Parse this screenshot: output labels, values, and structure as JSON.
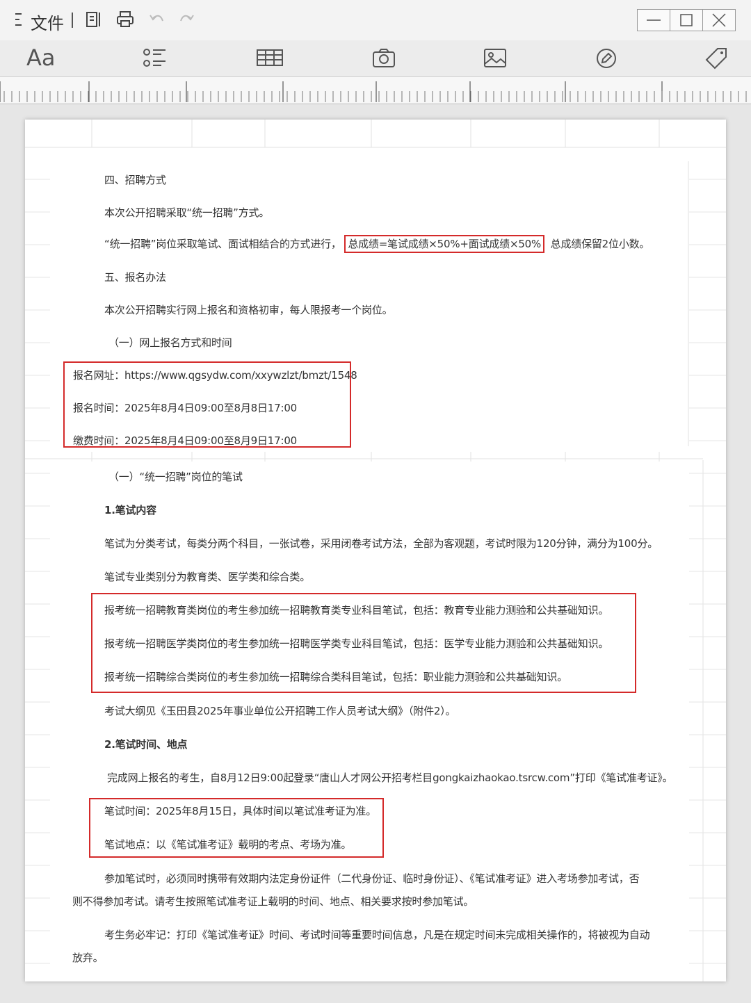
{
  "titlebar": {
    "menu_icon": "menu-icon",
    "file_label": "文件",
    "icons": [
      "preview-icon",
      "print-icon",
      "undo-icon",
      "redo-icon"
    ]
  },
  "window_controls": [
    "minimize-icon",
    "maximize-icon",
    "close-icon"
  ],
  "toolbar": {
    "font_label": "Aa",
    "icons": [
      "list-icon",
      "table-icon",
      "camera-icon",
      "image-icon",
      "edit-icon",
      "tag-icon"
    ]
  },
  "colors": {
    "highlight_border": "#d42a2a",
    "page_bg": "#ffffff",
    "app_bg": "#e6e6e6"
  },
  "document": {
    "s4_heading": "四、招聘方式",
    "s4_p1": "本次公开招聘采取“统一招聘”方式。",
    "s4_p2_pre": "“统一招聘”岗位采取笔试、面试相结合的方式进行，",
    "s4_p2_box": "总成绩=笔试成绩×50%+面试成绩×50%",
    "s4_p2_post": "总成绩保留2位小数。",
    "s5_heading": "五、报名办法",
    "s5_p1": "本次公开招聘实行网上报名和资格初审，每人限报考一个岗位。",
    "s5_sub1": "（一）网上报名方式和时间",
    "reg_url": "报名网址：https://www.qgsydw.com/xxywzlzt/bmzt/1548",
    "reg_time": "报名时间：2025年8月4日09:00至8月8日17:00",
    "pay_time": "缴费时间：2025年8月4日09:00至8月9日17:00",
    "exam_sub": "（一）“统一招聘”岗位的笔试",
    "exam_content_heading": "1.笔试内容",
    "exam_p1": "笔试为分类考试，每类分两个科目，一张试卷，采用闭卷考试方法，全部为客观题，考试时限为120分钟，满分为100分。",
    "exam_p2": "笔试专业类别分为教育类、医学类和综合类。",
    "exam_edu": "报考统一招聘教育类岗位的考生参加统一招聘教育类专业科目笔试，包括：教育专业能力测验和公共基础知识。",
    "exam_med": "报考统一招聘医学类岗位的考生参加统一招聘医学类专业科目笔试，包括：医学专业能力测验和公共基础知识。",
    "exam_gen": "报考统一招聘综合类岗位的考生参加统一招聘综合类科目笔试，包括：职业能力测验和公共基础知识。",
    "exam_outline": "考试大纲见《玉田县2025年事业单位公开招聘工作人员考试大纲》（附件2）。",
    "exam_time_heading": "2.笔试时间、地点",
    "exam_ticket": "完成网上报名的考生，自8月12日9:00起登录“唐山人才网公开招考栏目gongkaizhaokao.tsrcw.com”打印《笔试准考证》。",
    "exam_date": "笔试时间：2025年8月15日，具体时间以笔试准考证为准。",
    "exam_place": "笔试地点：以《笔试准考证》载明的考点、考场为准。",
    "exam_id_l1": "参加笔试时，必须同时携带有效期内法定身份证件（二代身份证、临时身份证）、《笔试准考证》进入考场参加考试，否",
    "exam_id_l2": "则不得参加考试。请考生按照笔试准考证上载明的时间、地点、相关要求按时参加笔试。",
    "exam_note_l1": "考生务必牢记：打印《笔试准考证》时间、考试时间等重要时间信息，凡是在规定时间未完成相关操作的，将被视为自动",
    "exam_note_l2": "放弃。"
  }
}
